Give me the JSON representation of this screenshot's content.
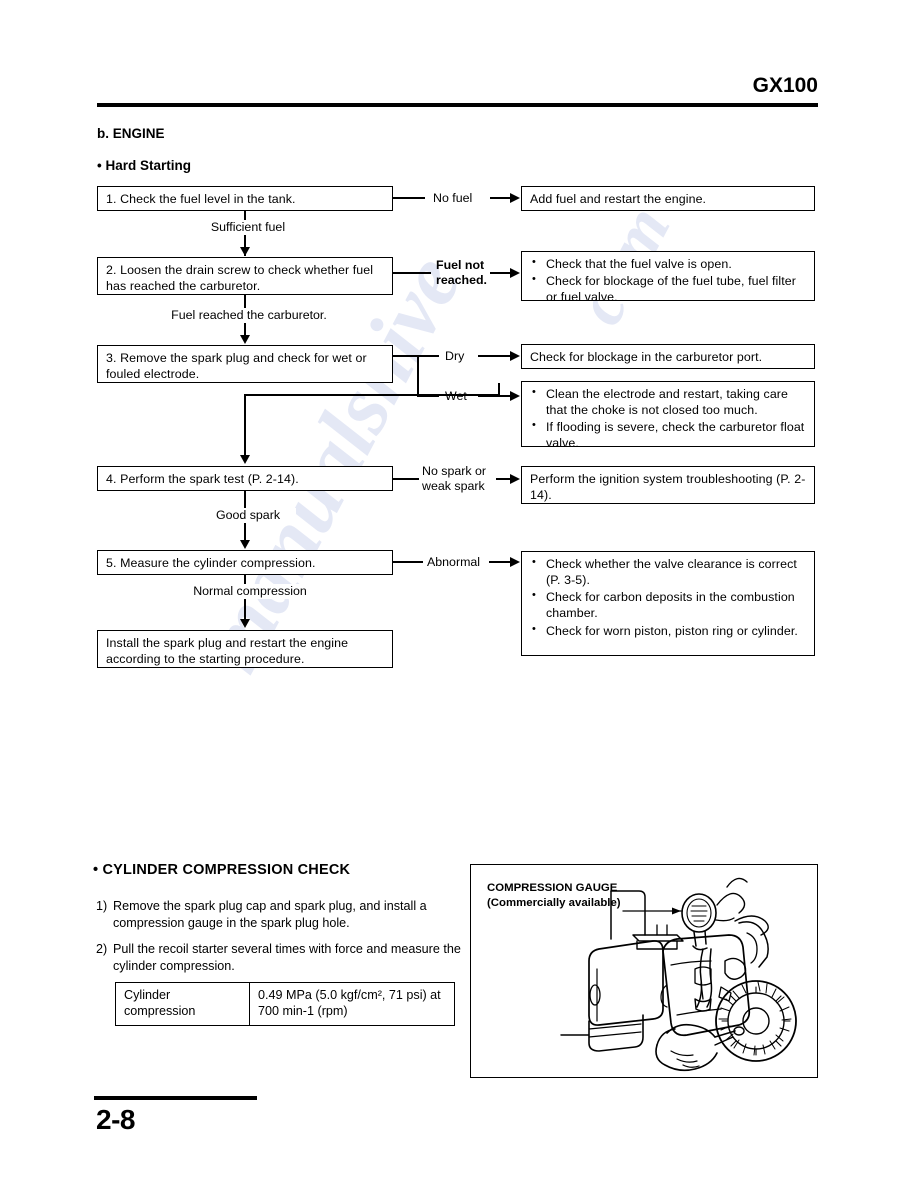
{
  "header": {
    "model_code": "GX100"
  },
  "headings": {
    "engine": "b. ENGINE",
    "hard_starting": "• Hard Starting",
    "cylinder_compression_check": "• CYLINDER COMPRESSION CHECK"
  },
  "flowchart": {
    "steps": [
      {
        "id": "step1",
        "text": "1.  Check the fuel level in the tank."
      },
      {
        "id": "step2",
        "text": "2.  Loosen  the  drain  screw  to  check  whether fuel has reached the carburetor."
      },
      {
        "id": "step3",
        "text": "3.  Remove  the  spark  plug  and  check  for  wet or fouled electrode."
      },
      {
        "id": "step4",
        "text": "4.  Perform the spark test (P. 2-14)."
      },
      {
        "id": "step5",
        "text": "5.  Measure the cylinder compression."
      },
      {
        "id": "step6",
        "text": "Install  the  spark  plug  and  restart  the  engine according to the starting procedure."
      }
    ],
    "flow_labels": [
      {
        "id": "flow1",
        "text": "Sufficient fuel"
      },
      {
        "id": "flow2",
        "text": "Fuel reached the carburetor."
      },
      {
        "id": "flow3",
        "text": "Good spark"
      },
      {
        "id": "flow4",
        "text": "Normal compression"
      }
    ],
    "branch_labels": [
      {
        "id": "branch-no-fuel",
        "text": "No fuel"
      },
      {
        "id": "branch-fuel-not-reached",
        "line1": "Fuel not",
        "line2": "reached."
      },
      {
        "id": "branch-dry",
        "text": "Dry"
      },
      {
        "id": "branch-wet",
        "text": "Wet"
      },
      {
        "id": "branch-no-spark",
        "line1": "No spark or",
        "line2": "weak spark"
      },
      {
        "id": "branch-abnormal",
        "text": "Abnormal"
      }
    ],
    "results": {
      "add_fuel": "Add fuel and restart the engine.",
      "fuel_valve_checks": [
        "Check that the fuel valve is open.",
        "Check for blockage of the fuel tube, fuel filter or fuel valve."
      ],
      "carburetor_port": "Check for blockage in the carburetor port.",
      "wet_checks": [
        "Clean the electrode and restart, taking care that the choke is not closed too much.",
        "If flooding is severe, check the carburetor float valve."
      ],
      "ignition_troubleshooting": "Perform  the  ignition  system  troubleshooting (P. 2-14).",
      "compression_checks": [
        "Check whether the valve clearance is correct (P. 3-5).",
        "Check for carbon deposits in the combustion chamber.",
        "Check for worn piston, piston ring or cylinder."
      ]
    }
  },
  "compression_check": {
    "steps": [
      {
        "marker": "1)",
        "text": "Remove the spark plug cap and spark plug, and install a compression gauge in the spark plug hole."
      },
      {
        "marker": "2)",
        "text": "Pull the recoil starter several times with force and measure the cylinder compression."
      }
    ],
    "spec_table": {
      "rows": [
        {
          "label": "Cylinder compression",
          "value": "0.49 MPa (5.0 kgf/cm², 71 psi) at 700 min-1 (rpm)"
        }
      ]
    },
    "illustration": {
      "caption_line1": "COMPRESSION GAUGE",
      "caption_line2": "(Commercially available)"
    }
  },
  "footer": {
    "page_number": "2-8"
  },
  "watermarks": [
    "manualshive",
    "com"
  ],
  "colors": {
    "ink": "#000000",
    "paper": "#ffffff",
    "watermark": "#7a8ccd"
  }
}
